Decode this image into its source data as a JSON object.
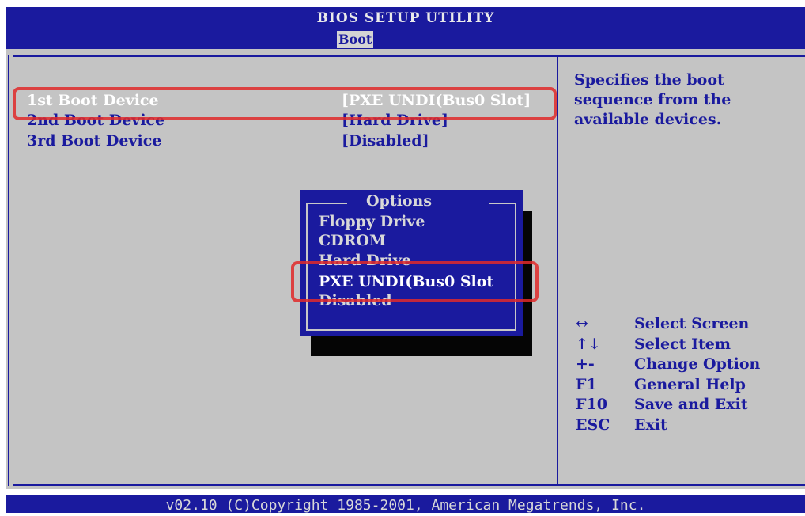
{
  "header": {
    "title": "BIOS SETUP UTILITY",
    "active_tab": "Boot"
  },
  "boot_devices": [
    {
      "label": "1st Boot Device",
      "value": "[PXE UNDI(Bus0 Slot]",
      "selected": true
    },
    {
      "label": "2nd Boot Device",
      "value": "[Hard Drive]",
      "selected": false
    },
    {
      "label": "3rd Boot Device",
      "value": "[Disabled]",
      "selected": false
    }
  ],
  "help": {
    "text": "Specifies the boot\nsequence from the\navailable devices."
  },
  "options_popup": {
    "title": "Options",
    "items": [
      "Floppy Drive",
      "CDROM",
      "Hard Drive",
      "PXE UNDI(Bus0 Slot",
      "Disabled"
    ],
    "selected_index": 3
  },
  "key_legend": [
    {
      "key": "↔",
      "description": "Select Screen"
    },
    {
      "key": "↑↓",
      "description": "Select Item"
    },
    {
      "key": "+-",
      "description": "Change Option"
    },
    {
      "key": "F1",
      "description": "General Help"
    },
    {
      "key": "F10",
      "description": "Save and Exit"
    },
    {
      "key": "ESC",
      "description": "Exit"
    }
  ],
  "footer": {
    "text": "v02.10 (C)Copyright 1985-2001, American Megatrends, Inc."
  },
  "colors": {
    "bios_blue": "#1a1a9e",
    "panel_gray": "#c4c4c4",
    "annotation_red": "#e02a2a"
  }
}
